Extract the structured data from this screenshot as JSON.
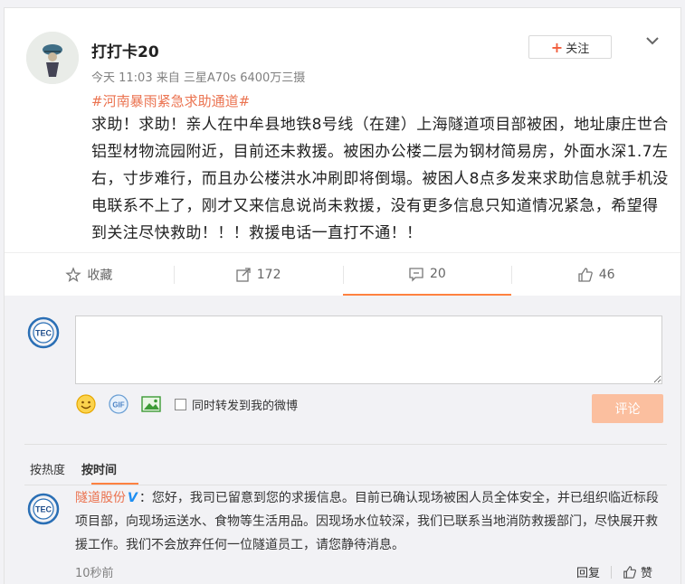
{
  "post": {
    "username": "打打卡20",
    "meta": "今天 11:03 来自 三星A70s 6400万三摄",
    "follow_label": "关注",
    "hashtag": "#河南暴雨紧急求助通道#",
    "body": "求助！求助！亲人在中牟县地铁8号线（在建）上海隧道项目部被困，地址康庄世合铝型材物流园附近，目前还未救援。被困办公楼二层为钢材简易房，外面水深1.7左右，寸步难行，而且办公楼洪水冲刷即将倒塌。被困人8点多发来求助信息就手机没电联系不上了，刚才又来信息说尚未救援，没有更多信息只知道情况紧急，希望得到关注尽快救助！！！救援电话一直打不通！！"
  },
  "actions": {
    "collect": "收藏",
    "repost": "172",
    "comment": "20",
    "like": "46"
  },
  "comment_box": {
    "repost_label": "同时转发到我的微博",
    "submit_label": "评论"
  },
  "sort": {
    "hot": "按热度",
    "time": "按时间"
  },
  "comment": {
    "name": "隧道股份",
    "text": "：您好，我司已留意到您的求援信息。目前已确认现场被困人员全体安全，并已组织临近标段项目部，向现场运送水、食物等生活用品。因现场水位较深，我们已联系当地消防救援部门，尽快展开救援工作。我们不会放弃任何一位隧道员工，请您静待消息。",
    "time": "10秒前",
    "reply": "回复",
    "like": "赞"
  },
  "logo_text": "TEC",
  "colors": {
    "accent": "#eb7350",
    "verified": "#1d8ef2",
    "submit": "#fbbf9f"
  },
  "icons": [
    "chevron-down-icon",
    "star-icon",
    "share-icon",
    "comment-icon",
    "thumbs-up-icon",
    "emoji-icon",
    "gif-icon",
    "image-icon"
  ]
}
